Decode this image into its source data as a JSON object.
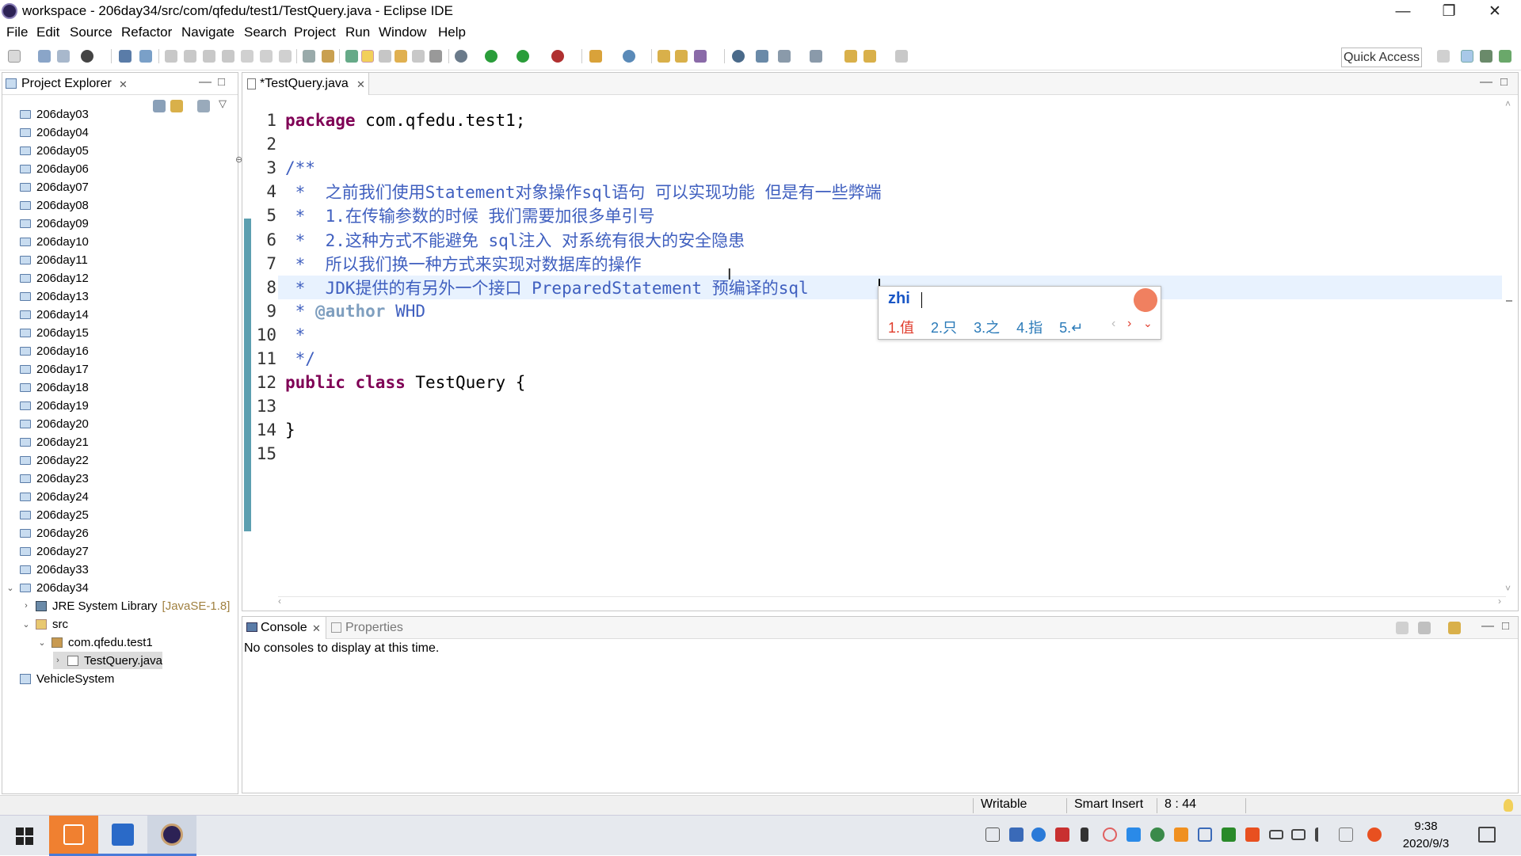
{
  "window": {
    "title": "workspace - 206day34/src/com/qfedu/test1/TestQuery.java - Eclipse IDE",
    "minimize": "—",
    "maximize": "❐",
    "close": "✕"
  },
  "menu": [
    "File",
    "Edit",
    "Source",
    "Refactor",
    "Navigate",
    "Search",
    "Project",
    "Run",
    "Window",
    "Help"
  ],
  "toolbar": {
    "quick_access": "Quick Access"
  },
  "project_explorer": {
    "title": "Project Explorer",
    "items": [
      {
        "label": "206day03"
      },
      {
        "label": "206day04"
      },
      {
        "label": "206day05"
      },
      {
        "label": "206day06"
      },
      {
        "label": "206day07"
      },
      {
        "label": "206day08"
      },
      {
        "label": "206day09"
      },
      {
        "label": "206day10"
      },
      {
        "label": "206day11"
      },
      {
        "label": "206day12"
      },
      {
        "label": "206day13"
      },
      {
        "label": "206day14"
      },
      {
        "label": "206day15"
      },
      {
        "label": "206day16"
      },
      {
        "label": "206day17"
      },
      {
        "label": "206day18"
      },
      {
        "label": "206day19"
      },
      {
        "label": "206day20"
      },
      {
        "label": "206day21"
      },
      {
        "label": "206day22"
      },
      {
        "label": "206day23"
      },
      {
        "label": "206day24"
      },
      {
        "label": "206day25"
      },
      {
        "label": "206day26"
      },
      {
        "label": "206day27"
      },
      {
        "label": "206day33"
      },
      {
        "label": "206day34"
      }
    ],
    "jre_label": "JRE System Library",
    "jre_version": "[JavaSE-1.8]",
    "src_label": "src",
    "package_label": "com.qfedu.test1",
    "file_label": "TestQuery.java",
    "vehicle_label": "VehicleSystem"
  },
  "editor": {
    "tab_label": "*TestQuery.java",
    "lines": [
      {
        "n": "1",
        "t1": "package",
        "t2": " com.qfedu.test1;"
      },
      {
        "n": "2"
      },
      {
        "n": "3",
        "c": "/**"
      },
      {
        "n": "4",
        "c": " *  之前我们使用Statement对象操作sql语句 可以实现功能 但是有一些弊端"
      },
      {
        "n": "5",
        "c": " *  1.在传输参数的时候 我们需要加很多单引号"
      },
      {
        "n": "6",
        "c": " *  2.这种方式不能避免 sql注入 对系统有很大的安全隐患"
      },
      {
        "n": "7",
        "c": " *  所以我们换一种方式来实现对数据库的操作"
      },
      {
        "n": "8",
        "c": " *  JDK提供的有另外一个接口 PreparedStatement 预编译的sql"
      },
      {
        "n": "9",
        "c": " * ",
        "tag": "@author",
        "c2": " WHD"
      },
      {
        "n": "10",
        "c": " *"
      },
      {
        "n": "11",
        "c": " */"
      },
      {
        "n": "12",
        "k1": "public",
        "k2": "class",
        "t": " TestQuery {"
      },
      {
        "n": "13"
      },
      {
        "n": "14",
        "t": "}"
      },
      {
        "n": "15"
      }
    ]
  },
  "ime": {
    "input": "zhi",
    "candidates": [
      "1.值",
      "2.只",
      "3.之",
      "4.指",
      "5.↵"
    ]
  },
  "console": {
    "tab_console": "Console",
    "tab_properties": "Properties",
    "message": "No consoles to display at this time."
  },
  "status": {
    "writable": "Writable",
    "insert_mode": "Smart Insert",
    "position": "8 : 44"
  },
  "taskbar": {
    "time": "9:38",
    "date": "2020/9/3"
  },
  "colors": {
    "keyword": "#7f0055",
    "comment": "#3f5fbf",
    "javadoc_tag": "#7f9fbf",
    "current_line": "#e8f2fe",
    "gutter_marker": "#5c9fb0"
  }
}
